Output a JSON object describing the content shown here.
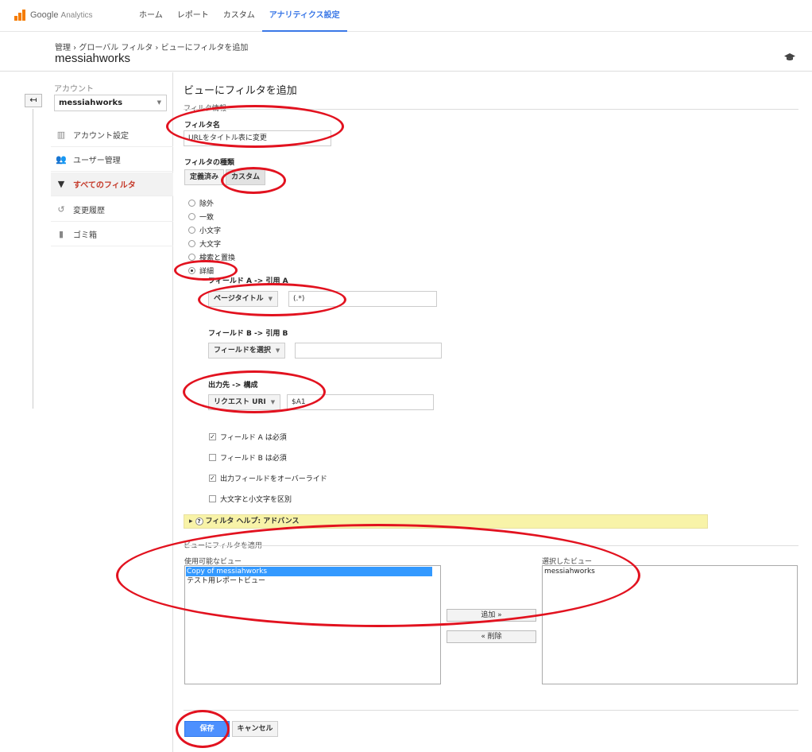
{
  "colors": {
    "accent": "#3b78e7",
    "annotation": "#e2121f",
    "active_nav": "#c53929",
    "selected_option": "#3399ff"
  },
  "logo": {
    "brand": "Google",
    "product": "Analytics"
  },
  "nav": [
    "ホーム",
    "レポート",
    "カスタム",
    "アナリティクス設定"
  ],
  "breadcrumb": "管理 › グローバル フィルタ › ビューにフィルタを追加",
  "account_title": "messiahworks",
  "sidebar": {
    "account_label": "アカウント",
    "account_value": "messiahworks",
    "items": [
      {
        "label": "アカウント設定",
        "icon": "building-icon"
      },
      {
        "label": "ユーザー管理",
        "icon": "users-icon"
      },
      {
        "label": "すべてのフィルタ",
        "icon": "filter-icon",
        "active": true
      },
      {
        "label": "変更履歴",
        "icon": "history-icon"
      },
      {
        "label": "ゴミ箱",
        "icon": "trash-icon"
      }
    ]
  },
  "form": {
    "page_title": "ビューにフィルタを追加",
    "section_info": "フィルタ情報",
    "filter_name_label": "フィルタ名",
    "filter_name_value": "URLをタイトル表に変更",
    "filter_type_label": "フィルタの種類",
    "type_tabs": [
      "定義済み",
      "カスタム"
    ],
    "custom_options": [
      "除外",
      "一致",
      "小文字",
      "大文字",
      "検索と置換",
      "詳細"
    ],
    "selected_option": "詳細",
    "field_a_label": "フィールド A -> 引用 A",
    "field_a_select": "ページタイトル",
    "field_a_value": "(.*)",
    "field_b_label": "フィールド B -> 引用 B",
    "field_b_select": "フィールドを選択",
    "field_b_value": "",
    "output_label": "出力先 -> 構成",
    "output_select": "リクエスト URI",
    "output_value": "$A1",
    "checkboxes": [
      {
        "label": "フィールド A は必須",
        "checked": true
      },
      {
        "label": "フィールド B は必須",
        "checked": false
      },
      {
        "label": "出力フィールドをオーバーライド",
        "checked": true
      },
      {
        "label": "大文字と小文字を区別",
        "checked": false
      }
    ],
    "help_text": "フィルタ ヘルプ: アドバンス",
    "apply_section": "ビューにフィルタを適用",
    "available_label": "使用可能なビュー",
    "available_views": [
      "Copy of messiahworks",
      "テスト用レポートビュー"
    ],
    "selected_label": "選択したビュー",
    "selected_views": [
      "messiahworks"
    ],
    "add_button": "追加 »",
    "remove_button": "« 削除",
    "save_button": "保存",
    "cancel_button": "キャンセル"
  }
}
